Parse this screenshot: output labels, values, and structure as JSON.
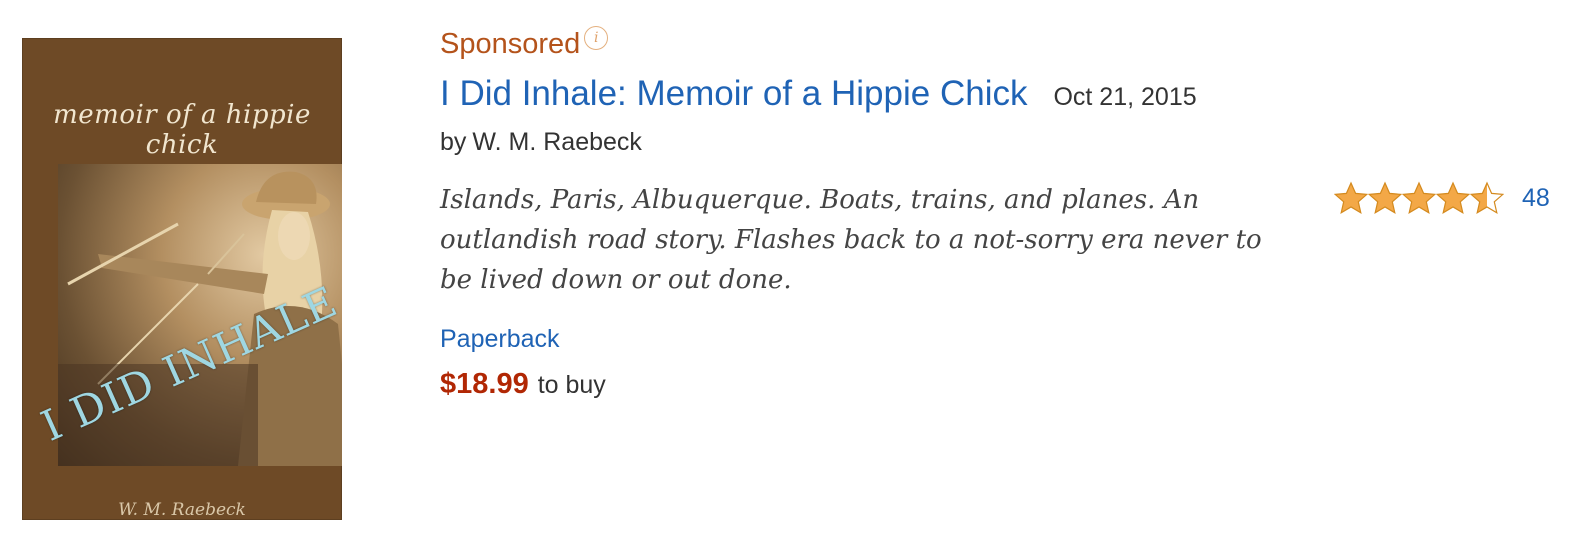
{
  "cover": {
    "title": "memoir of a hippie chick",
    "overlay_text": "I DID INHALE",
    "author": "W. M. Raebeck"
  },
  "sponsored": {
    "label": "Sponsored",
    "info_icon": "info-icon",
    "info_glyph": "i"
  },
  "product": {
    "title": "I Did Inhale: Memoir of a Hippie Chick",
    "date": "Oct 21, 2015",
    "by_label": "by",
    "author": "W. M. Raebeck",
    "description": "Islands, Paris, Albuquerque. Boats, trains, and planes. An outlandish road story. Flashes back to a not-sorry era never to be lived down or out done.",
    "format": "Paperback",
    "price": "$18.99",
    "price_suffix": "to buy"
  },
  "rating": {
    "stars": 4.5,
    "max_stars": 5,
    "count": "48",
    "star_color": "#f3a847"
  },
  "colors": {
    "link": "#1f63b5",
    "sponsored": "#b4531b",
    "price": "#b12704"
  }
}
